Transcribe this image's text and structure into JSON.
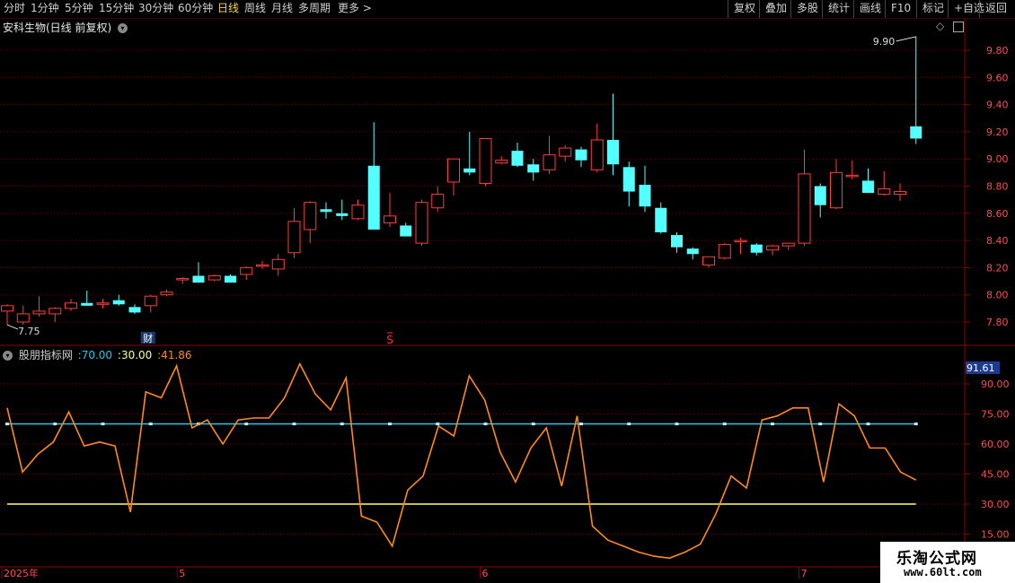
{
  "toolbar": {
    "periods": [
      "分时",
      "1分钟",
      "5分钟",
      "15分钟",
      "30分钟",
      "60分钟",
      "日线",
      "周线",
      "月线",
      "多周期",
      "更多 >"
    ],
    "active_period": "日线",
    "right_buttons": [
      "复权",
      "叠加",
      "多股",
      "统计",
      "画线",
      "F10",
      "+自选",
      "返回"
    ],
    "mark_label": "标记"
  },
  "main_chart": {
    "title": "安科生物(日线 前复权)",
    "high_label": "9.90",
    "low_label": "7.75",
    "fin_marker": "财",
    "s_marker": "S",
    "colors": {
      "up": "#ff3d3d",
      "down": "#54ffff"
    }
  },
  "indicator": {
    "name": "股朋指标网",
    "params": [
      ":70.00",
      ":30.00",
      ":41.86"
    ],
    "current_value_label": "91.61",
    "colors": {
      "line": "#ff8a1a",
      "upper": "#22c8e6",
      "lower": "#ffff66"
    }
  },
  "watermark": {
    "line1": "乐淘公式网",
    "line2": "www.60lt.com"
  },
  "chart_data": [
    {
      "type": "candlestick",
      "title": "安科生物(日线 前复权)",
      "y_ticks": [
        "9.80",
        "9.60",
        "9.40",
        "9.20",
        "9.00",
        "8.80",
        "8.60",
        "8.40",
        "8.20",
        "8.00",
        "7.80"
      ],
      "ylim": [
        7.63,
        10.0
      ],
      "x_tick_labels": [
        "2025年",
        "5",
        "6",
        "7"
      ],
      "x_tick_index": [
        0,
        11,
        30,
        50
      ],
      "ohlc": [
        [
          7.88,
          7.93,
          7.78,
          7.92
        ],
        [
          7.8,
          7.92,
          7.78,
          7.86
        ],
        [
          7.86,
          7.99,
          7.84,
          7.88
        ],
        [
          7.86,
          7.91,
          7.8,
          7.9
        ],
        [
          7.9,
          7.97,
          7.88,
          7.94
        ],
        [
          7.94,
          8.03,
          7.92,
          7.92
        ],
        [
          7.93,
          7.97,
          7.9,
          7.94
        ],
        [
          7.96,
          8.0,
          7.92,
          7.93
        ],
        [
          7.91,
          7.93,
          7.86,
          7.87
        ],
        [
          7.92,
          8.0,
          7.87,
          7.99
        ],
        [
          8.0,
          8.04,
          7.99,
          8.02
        ],
        [
          8.11,
          8.13,
          8.08,
          8.12
        ],
        [
          8.14,
          8.24,
          8.09,
          8.09
        ],
        [
          8.11,
          8.15,
          8.1,
          8.14
        ],
        [
          8.14,
          8.15,
          8.09,
          8.09
        ],
        [
          8.15,
          8.21,
          8.11,
          8.2
        ],
        [
          8.21,
          8.25,
          8.19,
          8.22
        ],
        [
          8.19,
          8.3,
          8.14,
          8.26
        ],
        [
          8.31,
          8.64,
          8.27,
          8.54
        ],
        [
          8.48,
          8.69,
          8.38,
          8.68
        ],
        [
          8.63,
          8.68,
          8.56,
          8.61
        ],
        [
          8.6,
          8.7,
          8.55,
          8.58
        ],
        [
          8.56,
          8.7,
          8.55,
          8.66
        ],
        [
          8.95,
          9.27,
          8.49,
          8.48
        ],
        [
          8.53,
          8.75,
          8.5,
          8.58
        ],
        [
          8.51,
          8.53,
          8.43,
          8.43
        ],
        [
          8.38,
          8.7,
          8.36,
          8.68
        ],
        [
          8.64,
          8.8,
          8.61,
          8.74
        ],
        [
          8.83,
          9.0,
          8.73,
          9.0
        ],
        [
          8.93,
          9.2,
          8.88,
          8.9
        ],
        [
          8.82,
          9.15,
          8.8,
          9.15
        ],
        [
          8.97,
          9.02,
          8.96,
          8.99
        ],
        [
          9.06,
          9.12,
          8.94,
          8.95
        ],
        [
          8.96,
          9.0,
          8.84,
          8.9
        ],
        [
          8.92,
          9.17,
          8.89,
          9.03
        ],
        [
          9.02,
          9.1,
          8.98,
          9.08
        ],
        [
          9.07,
          9.09,
          8.94,
          8.99
        ],
        [
          8.92,
          9.26,
          8.9,
          9.14
        ],
        [
          9.14,
          9.48,
          8.88,
          8.96
        ],
        [
          8.94,
          8.98,
          8.65,
          8.76
        ],
        [
          8.81,
          8.95,
          8.61,
          8.65
        ],
        [
          8.64,
          8.68,
          8.45,
          8.46
        ],
        [
          8.44,
          8.46,
          8.31,
          8.35
        ],
        [
          8.34,
          8.35,
          8.26,
          8.3
        ],
        [
          8.22,
          8.26,
          8.2,
          8.28
        ],
        [
          8.27,
          8.38,
          8.26,
          8.37
        ],
        [
          8.4,
          8.42,
          8.3,
          8.4
        ],
        [
          8.37,
          8.38,
          8.29,
          8.31
        ],
        [
          8.33,
          8.37,
          8.29,
          8.36
        ],
        [
          8.36,
          8.38,
          8.33,
          8.38
        ],
        [
          8.38,
          9.07,
          8.36,
          8.89
        ],
        [
          8.8,
          8.82,
          8.57,
          8.66
        ],
        [
          8.64,
          9.0,
          8.63,
          8.9
        ],
        [
          8.87,
          8.99,
          8.85,
          8.88
        ],
        [
          8.84,
          8.93,
          8.75,
          8.75
        ],
        [
          8.74,
          8.91,
          8.73,
          8.78
        ],
        [
          8.74,
          8.82,
          8.69,
          8.76
        ],
        [
          9.24,
          9.9,
          9.11,
          9.15
        ]
      ]
    },
    {
      "type": "line",
      "title": "股朋指标网",
      "y_ticks": [
        "90.00",
        "75.00",
        "60.00",
        "45.00",
        "30.00",
        "15.00"
      ],
      "ylim": [
        12,
        103
      ],
      "series": [
        {
          "name": "",
          "values": [
            78,
            46,
            55,
            61,
            76,
            59,
            61,
            59,
            26,
            86,
            83,
            99,
            68,
            72,
            60,
            72,
            73,
            73,
            83,
            100,
            85,
            77,
            93,
            24,
            21,
            9,
            37,
            44,
            69,
            64,
            94,
            82,
            56,
            41,
            58,
            68,
            39,
            74,
            19,
            12,
            9,
            6,
            4,
            3,
            6,
            10,
            25,
            44,
            38,
            72,
            74,
            78,
            78,
            41,
            80,
            74,
            58,
            58,
            46,
            42
          ]
        },
        {
          "name": "",
          "values": [
            70
          ]
        },
        {
          "name": "",
          "values": [
            30
          ]
        }
      ]
    }
  ]
}
